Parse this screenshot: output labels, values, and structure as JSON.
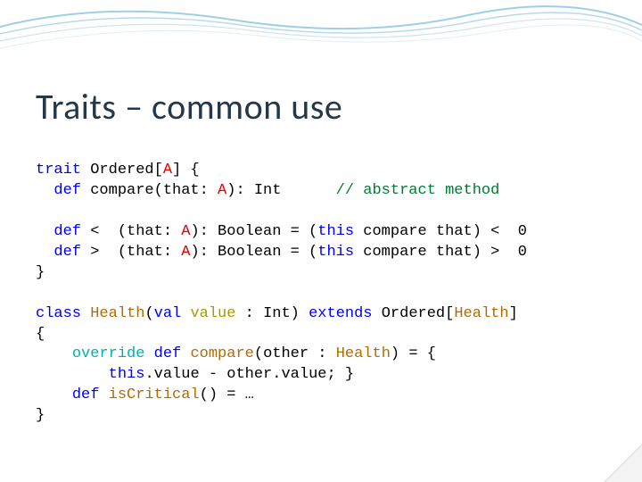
{
  "title": "Traits – common use",
  "code": {
    "l1_kw": "trait",
    "l1_name": " Ordered[",
    "l1_A": "A",
    "l1_rest": "] {",
    "l2_indent": "  ",
    "l2_kw": "def",
    "l2_rest": " compare(that: ",
    "l2_A": "A",
    "l2_rest2": "): Int      ",
    "l2_comment": "// abstract method",
    "blank1": "",
    "l3_indent": "  ",
    "l3_kw": "def",
    "l3_op": " <  (that: ",
    "l3_A": "A",
    "l3_rest": "): Boolean = (",
    "l3_this": "this",
    "l3_rest2": " compare that) <  0",
    "l4_indent": "  ",
    "l4_kw": "def",
    "l4_op": " >  (that: ",
    "l4_A": "A",
    "l4_rest": "): Boolean = (",
    "l4_this": "this",
    "l4_rest2": " compare that) >  0",
    "l5": "}",
    "blank2": "",
    "l6_kw": "class",
    "l6_name": " Health",
    "l6_paren": "(",
    "l6_valkw": "val",
    "l6_val": " value",
    "l6_rest": " : Int) ",
    "l6_ext": "extends",
    "l6_rest2": " Ordered[",
    "l6_cls": "Health",
    "l6_rest3": "]",
    "l7": "{",
    "l8_indent": "    ",
    "l8_over": "override",
    "l8_sp": " ",
    "l8_def": "def",
    "l8_name": " compare",
    "l8_rest": "(other : ",
    "l8_cls": "Health",
    "l8_rest2": ") = {",
    "l9_indent": "        ",
    "l9_this1": "this",
    "l9_mid": ".value - other.value; }",
    "l10_indent": "    ",
    "l10_kw": "def",
    "l10_name": " isCritical",
    "l10_rest": "() = …",
    "l11": "}"
  }
}
